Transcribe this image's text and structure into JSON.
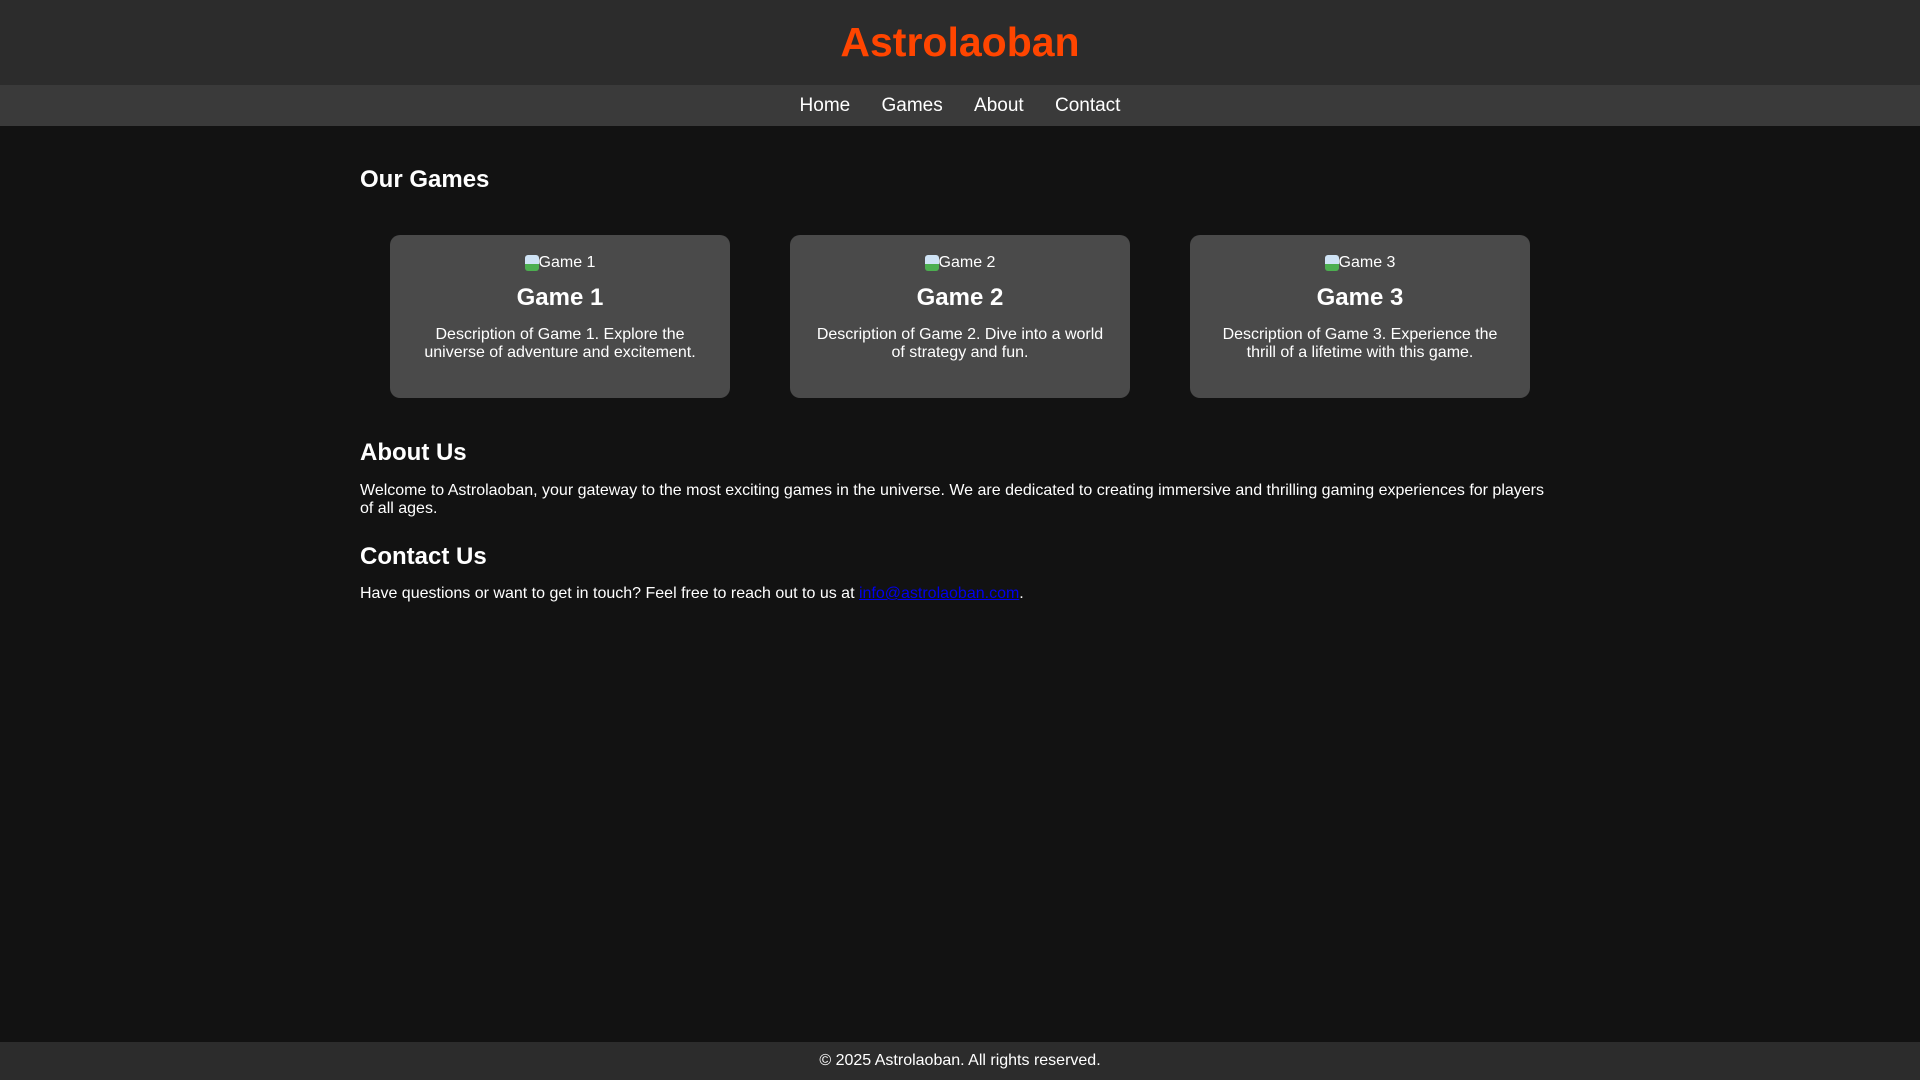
{
  "site_title": "Astrolaoban",
  "nav": [
    "Home",
    "Games",
    "About",
    "Contact"
  ],
  "games": {
    "heading": "Our Games",
    "cards": [
      {
        "img_alt": "Game 1",
        "title": "Game 1",
        "desc": "Description of Game 1. Explore the universe of adventure and excitement."
      },
      {
        "img_alt": "Game 2",
        "title": "Game 2",
        "desc": "Description of Game 2. Dive into a world of strategy and fun."
      },
      {
        "img_alt": "Game 3",
        "title": "Game 3",
        "desc": "Description of Game 3. Experience the thrill of a lifetime with this game."
      }
    ]
  },
  "about": {
    "heading": "About Us",
    "text": "Welcome to Astrolaoban, your gateway to the most exciting games in the universe. We are dedicated to creating immersive and thrilling gaming experiences for players of all ages."
  },
  "contact": {
    "heading": "Contact Us",
    "text": "Have questions or want to get in touch? Feel free to reach out to us at ",
    "email": "info@astrolaoban.com",
    "end": "."
  },
  "footer": "© 2025 Astrolaoban. All rights reserved."
}
